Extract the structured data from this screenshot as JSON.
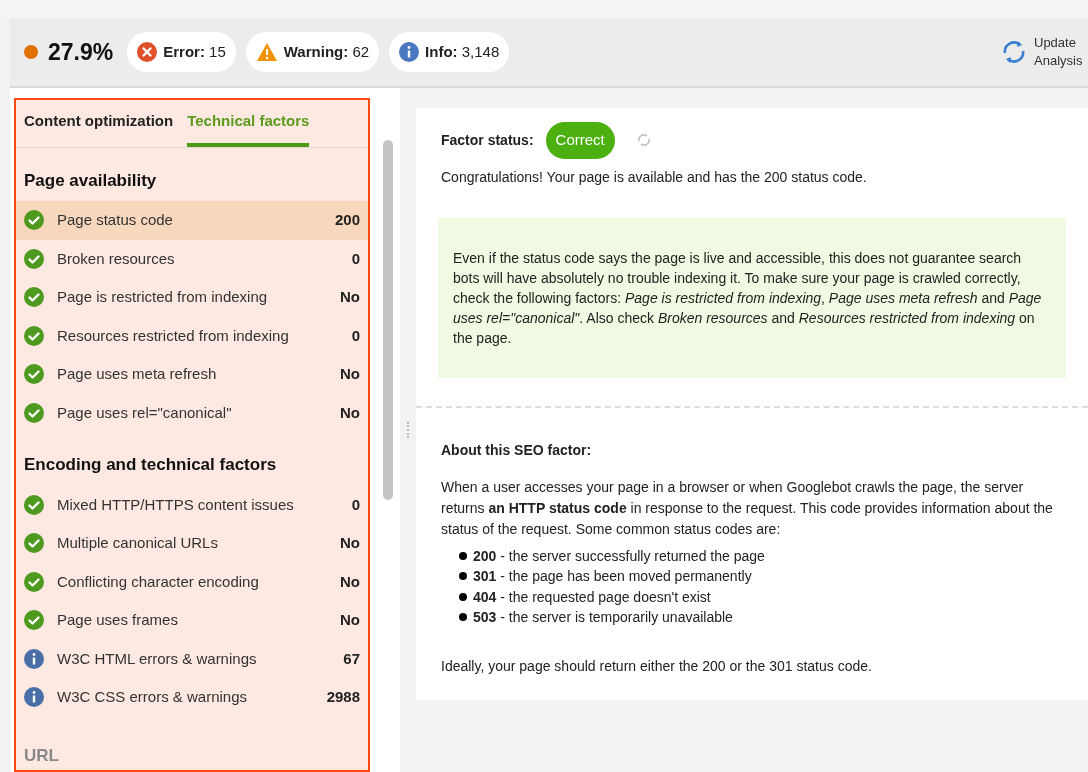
{
  "header": {
    "score": "27.9%",
    "score_dot": {
      "color": "#e07000"
    },
    "badges": [
      {
        "kind": "error",
        "label": "Error:",
        "count": "15"
      },
      {
        "kind": "warning",
        "label": "Warning:",
        "count": "62"
      },
      {
        "kind": "info",
        "label": "Info:",
        "count": "3,148"
      }
    ],
    "update_button": "Update Analysis"
  },
  "tabs": [
    {
      "label": "Content optimization",
      "selected": false
    },
    {
      "label": "Technical factors",
      "selected": true
    }
  ],
  "sections": [
    {
      "title": "Page availability",
      "items": [
        {
          "kind": "ok",
          "label": "Page status code",
          "value": "200",
          "selected": true
        },
        {
          "kind": "ok",
          "label": "Broken resources",
          "value": "0",
          "selected": false
        },
        {
          "kind": "ok",
          "label": "Page is restricted from indexing",
          "value": "No",
          "selected": false
        },
        {
          "kind": "ok",
          "label": "Resources restricted from indexing",
          "value": "0",
          "selected": false
        },
        {
          "kind": "ok",
          "label": "Page uses meta refresh",
          "value": "No",
          "selected": false
        },
        {
          "kind": "ok",
          "label": "Page uses rel=\"canonical\"",
          "value": "No",
          "selected": false
        }
      ]
    },
    {
      "title": "Encoding and technical factors",
      "items": [
        {
          "kind": "ok",
          "label": "Mixed HTTP/HTTPS content issues",
          "value": "0",
          "selected": false
        },
        {
          "kind": "ok",
          "label": "Multiple canonical URLs",
          "value": "No",
          "selected": false
        },
        {
          "kind": "ok",
          "label": "Conflicting character encoding",
          "value": "No",
          "selected": false
        },
        {
          "kind": "ok",
          "label": "Page uses frames",
          "value": "No",
          "selected": false
        },
        {
          "kind": "info",
          "label": "W3C HTML errors & warnings",
          "value": "67",
          "selected": false
        },
        {
          "kind": "info",
          "label": "W3C CSS errors & warnings",
          "value": "2988",
          "selected": false
        }
      ]
    }
  ],
  "next_section": "URL",
  "detail": {
    "status_label": "Factor status:",
    "status": "Correct",
    "kind": "correct",
    "summary": "Congratulations! Your page is available and has the 200 status code.",
    "note": "Even if the status code says the page is live and accessible, this does not guarantee search bots will have absolutely no trouble indexing it. To make sure your page is crawled correctly, check the following factors: *Page is restricted from indexing*, *Page uses meta refresh* and *Page uses rel=\"canonical\"*. Also check *Broken resources* and *Resources restricted from indexing* on the page.",
    "about_title": "About this SEO factor:",
    "about_text": "When a user accesses your page in a browser or when Googlebot crawls the page, the server returns **an HTTP status code** in response to the request. This code provides information about the status of the request. Some common status codes are:",
    "codes": [
      {
        "code": "200",
        "text": "- the server successfully returned the page"
      },
      {
        "code": "301",
        "text": "- the page has been moved permanently"
      },
      {
        "code": "404",
        "text": "- the requested page doesn't exist"
      },
      {
        "code": "503",
        "text": "- the server is temporarily unavailable"
      }
    ],
    "conclusion": "Ideally, your page should return either the 200 or the 301 status code."
  }
}
